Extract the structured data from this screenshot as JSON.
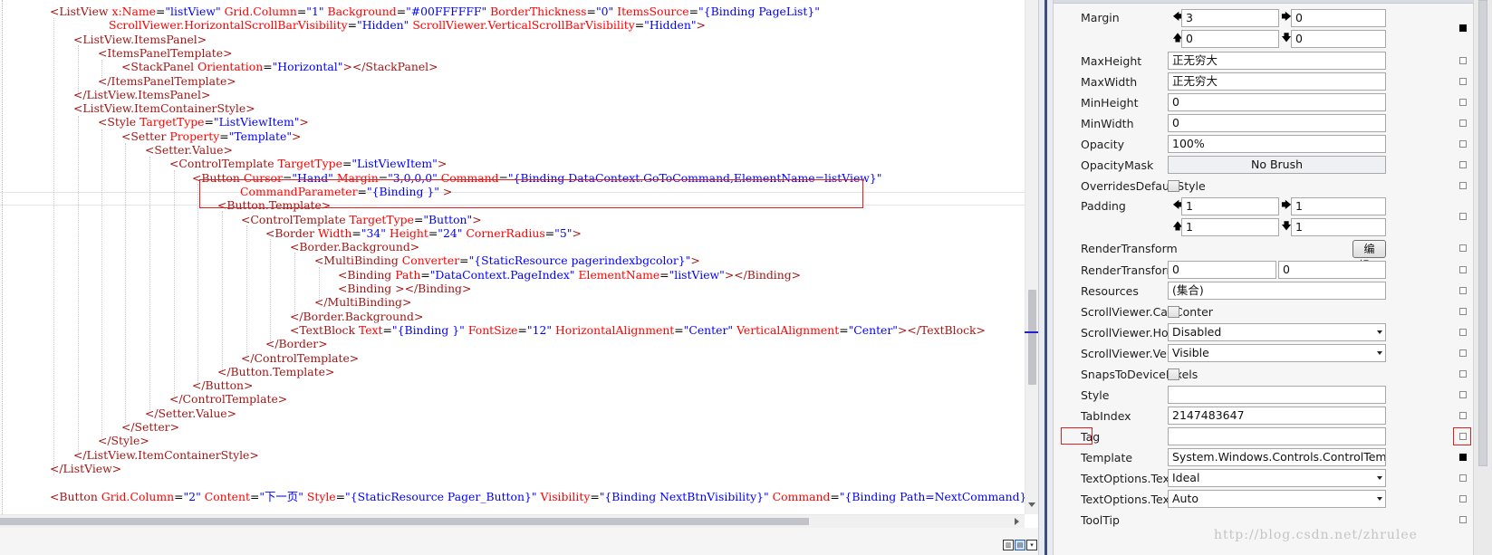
{
  "editor": {
    "lines": [
      [
        [
          "b",
          "<ListView "
        ],
        [
          "a",
          "x:Name"
        ],
        [
          "t",
          "="
        ],
        [
          "v",
          "\"listView\""
        ],
        [
          "t",
          " "
        ],
        [
          "a",
          "Grid.Column"
        ],
        [
          "t",
          "="
        ],
        [
          "v",
          "\"1\""
        ],
        [
          "t",
          " "
        ],
        [
          "a",
          "Background"
        ],
        [
          "t",
          "="
        ],
        [
          "v",
          "\"#00FFFFFF\""
        ],
        [
          "t",
          " "
        ],
        [
          "a",
          "BorderThickness"
        ],
        [
          "t",
          "="
        ],
        [
          "v",
          "\"0\""
        ],
        [
          "t",
          " "
        ],
        [
          "a",
          "ItemsSource"
        ],
        [
          "t",
          "="
        ],
        [
          "v",
          "\"{Binding PageList}\""
        ]
      ],
      [
        [
          "a",
          "ScrollViewer.HorizontalScrollBarVisibility"
        ],
        [
          "t",
          "="
        ],
        [
          "v",
          "\"Hidden\""
        ],
        [
          "t",
          " "
        ],
        [
          "a",
          "ScrollViewer.VerticalScrollBarVisibility"
        ],
        [
          "t",
          "="
        ],
        [
          "v",
          "\"Hidden\""
        ],
        [
          "b",
          ">"
        ]
      ],
      [
        [
          "b",
          "<ListView.ItemsPanel>"
        ]
      ],
      [
        [
          "b",
          "<ItemsPanelTemplate>"
        ]
      ],
      [
        [
          "b",
          "<StackPanel "
        ],
        [
          "a",
          "Orientation"
        ],
        [
          "t",
          "="
        ],
        [
          "v",
          "\"Horizontal\""
        ],
        [
          "b",
          "></StackPanel>"
        ]
      ],
      [
        [
          "b",
          "</ItemsPanelTemplate>"
        ]
      ],
      [
        [
          "b",
          "</ListView.ItemsPanel>"
        ]
      ],
      [
        [
          "b",
          "<ListView.ItemContainerStyle>"
        ]
      ],
      [
        [
          "b",
          "<Style "
        ],
        [
          "a",
          "TargetType"
        ],
        [
          "t",
          "="
        ],
        [
          "v",
          "\"ListViewItem\""
        ],
        [
          "b",
          ">"
        ]
      ],
      [
        [
          "b",
          "<Setter "
        ],
        [
          "a",
          "Property"
        ],
        [
          "t",
          "="
        ],
        [
          "v",
          "\"Template\""
        ],
        [
          "b",
          ">"
        ]
      ],
      [
        [
          "b",
          "<Setter.Value>"
        ]
      ],
      [
        [
          "b",
          "<ControlTemplate "
        ],
        [
          "a",
          "TargetType"
        ],
        [
          "t",
          "="
        ],
        [
          "v",
          "\"ListViewItem\""
        ],
        [
          "b",
          ">"
        ]
      ],
      [
        [
          "b",
          "<Button "
        ],
        [
          "a",
          "Cursor"
        ],
        [
          "t",
          "="
        ],
        [
          "v",
          "\"Hand\""
        ],
        [
          "t",
          " "
        ],
        [
          "a",
          "Margin"
        ],
        [
          "t",
          "="
        ],
        [
          "v",
          "\"3,0,0,0\""
        ],
        [
          "t",
          " "
        ],
        [
          "a",
          "Command"
        ],
        [
          "t",
          "="
        ],
        [
          "v",
          "\"{Binding DataContext.GoToCommand,ElementName=listView}\""
        ]
      ],
      [
        [
          "a",
          "CommandParameter"
        ],
        [
          "t",
          "="
        ],
        [
          "v",
          "\"{Binding }\""
        ],
        [
          "t",
          " "
        ],
        [
          "b",
          ">"
        ]
      ],
      [
        [
          "b",
          "<Button.Template>"
        ]
      ],
      [
        [
          "b",
          "<ControlTemplate "
        ],
        [
          "a",
          "TargetType"
        ],
        [
          "t",
          "="
        ],
        [
          "v",
          "\"Button\""
        ],
        [
          "b",
          ">"
        ]
      ],
      [
        [
          "b",
          "<Border "
        ],
        [
          "a",
          "Width"
        ],
        [
          "t",
          "="
        ],
        [
          "v",
          "\"34\""
        ],
        [
          "t",
          " "
        ],
        [
          "a",
          "Height"
        ],
        [
          "t",
          "="
        ],
        [
          "v",
          "\"24\""
        ],
        [
          "t",
          " "
        ],
        [
          "a",
          "CornerRadius"
        ],
        [
          "t",
          "="
        ],
        [
          "v",
          "\"5\""
        ],
        [
          "b",
          ">"
        ]
      ],
      [
        [
          "b",
          "<Border.Background>"
        ]
      ],
      [
        [
          "b",
          "<MultiBinding "
        ],
        [
          "a",
          "Converter"
        ],
        [
          "t",
          "="
        ],
        [
          "v",
          "\"{StaticResource pagerindexbgcolor}\""
        ],
        [
          "b",
          ">"
        ]
      ],
      [
        [
          "b",
          "<Binding "
        ],
        [
          "a",
          "Path"
        ],
        [
          "t",
          "="
        ],
        [
          "v",
          "\"DataContext.PageIndex\""
        ],
        [
          "t",
          " "
        ],
        [
          "a",
          "ElementName"
        ],
        [
          "t",
          "="
        ],
        [
          "v",
          "\"listView\""
        ],
        [
          "b",
          "></Binding>"
        ]
      ],
      [
        [
          "b",
          "<Binding "
        ],
        [
          "b",
          "></Binding>"
        ]
      ],
      [
        [
          "b",
          "</MultiBinding>"
        ]
      ],
      [
        [
          "b",
          "</Border.Background>"
        ]
      ],
      [
        [
          "b",
          "<TextBlock "
        ],
        [
          "a",
          "Text"
        ],
        [
          "t",
          "="
        ],
        [
          "v",
          "\"{Binding }\""
        ],
        [
          "t",
          " "
        ],
        [
          "a",
          "FontSize"
        ],
        [
          "t",
          "="
        ],
        [
          "v",
          "\"12\""
        ],
        [
          "t",
          " "
        ],
        [
          "a",
          "HorizontalAlignment"
        ],
        [
          "t",
          "="
        ],
        [
          "v",
          "\"Center\""
        ],
        [
          "t",
          " "
        ],
        [
          "a",
          "VerticalAlignment"
        ],
        [
          "t",
          "="
        ],
        [
          "v",
          "\"Center\""
        ],
        [
          "b",
          "></TextBlock>"
        ]
      ],
      [
        [
          "b",
          "</Border>"
        ]
      ],
      [
        [
          "b",
          "</ControlTemplate>"
        ]
      ],
      [
        [
          "b",
          "</Button.Template>"
        ]
      ],
      [
        [
          "b",
          "</Button>"
        ]
      ],
      [
        [
          "b",
          "</ControlTemplate>"
        ]
      ],
      [
        [
          "b",
          "</Setter.Value>"
        ]
      ],
      [
        [
          "b",
          "</Setter>"
        ]
      ],
      [
        [
          "b",
          "</Style>"
        ]
      ],
      [
        [
          "b",
          "</ListView.ItemContainerStyle>"
        ]
      ],
      [
        [
          "b",
          "</ListView>"
        ]
      ],
      [],
      [
        [
          "b",
          "<Button "
        ],
        [
          "a",
          "Grid.Column"
        ],
        [
          "t",
          "="
        ],
        [
          "v",
          "\"2\""
        ],
        [
          "t",
          " "
        ],
        [
          "a",
          "Content"
        ],
        [
          "t",
          "="
        ],
        [
          "v",
          "\"下一页\""
        ],
        [
          "t",
          " "
        ],
        [
          "a",
          "Style"
        ],
        [
          "t",
          "="
        ],
        [
          "v",
          "\"{StaticResource Pager_Button}\""
        ],
        [
          "t",
          " "
        ],
        [
          "a",
          "Visibility"
        ],
        [
          "t",
          "="
        ],
        [
          "v",
          "\"{Binding NextBtnVisibility}\""
        ],
        [
          "t",
          " "
        ],
        [
          "a",
          "Command"
        ],
        [
          "t",
          "="
        ],
        [
          "v",
          "\"{Binding Path=NextCommand}\""
        ]
      ]
    ]
  },
  "properties": {
    "margin": {
      "label": "Margin",
      "left": "3",
      "right": "0",
      "top": "0",
      "bottom": "0"
    },
    "max_height": {
      "label": "MaxHeight",
      "value": "正无穷大"
    },
    "max_width": {
      "label": "MaxWidth",
      "value": "正无穷大"
    },
    "min_height": {
      "label": "MinHeight",
      "value": "0"
    },
    "min_width": {
      "label": "MinWidth",
      "value": "0"
    },
    "opacity": {
      "label": "Opacity",
      "value": "100%"
    },
    "opacity_mask": {
      "label": "OpacityMask",
      "value": "No Brush"
    },
    "overrides_default_style": {
      "label": "OverridesDefaultStyle"
    },
    "padding": {
      "label": "Padding",
      "left": "1",
      "right": "1",
      "top": "1",
      "bottom": "1"
    },
    "render_transform": {
      "label": "RenderTransform",
      "button": "编辑..."
    },
    "render_transform_origin": {
      "label": "RenderTransformOrigin",
      "x": "0",
      "y": "0"
    },
    "resources": {
      "label": "Resources",
      "value": "(集合)"
    },
    "sv_can_content": {
      "label": "ScrollViewer.CanContent..."
    },
    "sv_horizontal": {
      "label": "ScrollViewer.HorizontalS...",
      "value": "Disabled"
    },
    "sv_vertical": {
      "label": "ScrollViewer.VerticalScrol...",
      "value": "Visible"
    },
    "snaps_to_device_pixels": {
      "label": "SnapsToDevicePixels"
    },
    "style": {
      "label": "Style",
      "value": ""
    },
    "tab_index": {
      "label": "TabIndex",
      "value": "2147483647"
    },
    "tag": {
      "label": "Tag",
      "value": ""
    },
    "template": {
      "label": "Template",
      "value": "System.Windows.Controls.ControlTempl..."
    },
    "text_formatting": {
      "label": "TextOptions.TextFormatti...",
      "value": "Ideal"
    },
    "text_hinting": {
      "label": "TextOptions.TextHinting...",
      "value": "Auto"
    },
    "tooltip": {
      "label": "ToolTip",
      "value": ""
    }
  },
  "watermark": "http://blog.csdn.net/zhrulee",
  "icons": {
    "arrow_left": "arrow-left-icon",
    "arrow_right": "arrow-right-icon",
    "arrow_up": "arrow-up-icon",
    "arrow_down": "arrow-down-icon"
  },
  "colors": {
    "tag": "#a31515",
    "attribute": "#ff0000",
    "value": "#0000ff",
    "highlight": "#e02020"
  }
}
